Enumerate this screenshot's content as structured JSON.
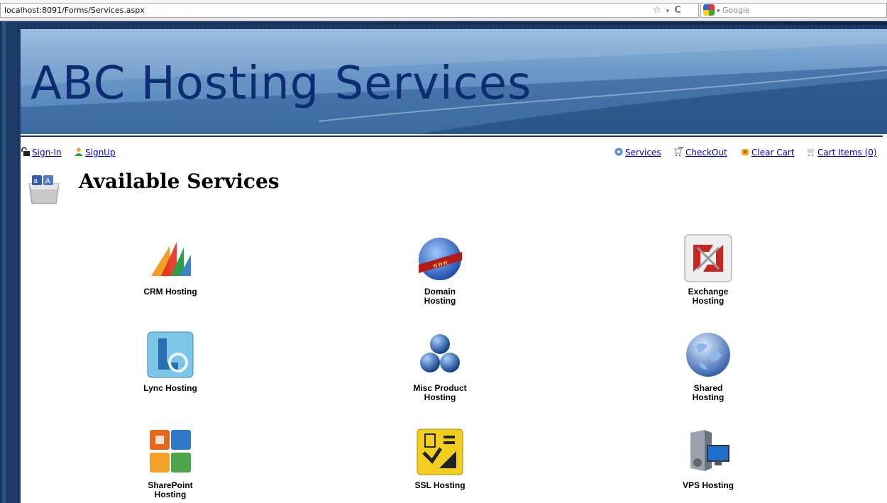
{
  "browser": {
    "url": "localhost:8091/Forms/Services.aspx",
    "search_placeholder": "Google"
  },
  "banner": {
    "title": "ABC Hosting Services"
  },
  "toolbar": {
    "signin": "Sign-In",
    "signup": "SignUp",
    "services": "Services",
    "checkout": "CheckOut",
    "clear_cart": "Clear Cart",
    "cart_items": "Cart Items (0)"
  },
  "page": {
    "title": "Available Services"
  },
  "services": [
    {
      "label_1": "CRM Hosting",
      "label_2": "",
      "icon": "crm-icon"
    },
    {
      "label_1": "Domain",
      "label_2": "Hosting",
      "icon": "domain-globe-icon"
    },
    {
      "label_1": "Exchange",
      "label_2": "Hosting",
      "icon": "exchange-icon"
    },
    {
      "label_1": "Lync Hosting",
      "label_2": "",
      "icon": "lync-icon"
    },
    {
      "label_1": "Misc Product",
      "label_2": "Hosting",
      "icon": "misc-spheres-icon"
    },
    {
      "label_1": "Shared",
      "label_2": "Hosting",
      "icon": "shared-globe-icon"
    },
    {
      "label_1": "SharePoint",
      "label_2": "Hosting",
      "icon": "sharepoint-icon"
    },
    {
      "label_1": "SSL Hosting",
      "label_2": "",
      "icon": "ssl-icon"
    },
    {
      "label_1": "VPS Hosting",
      "label_2": "",
      "icon": "vps-server-icon"
    }
  ]
}
